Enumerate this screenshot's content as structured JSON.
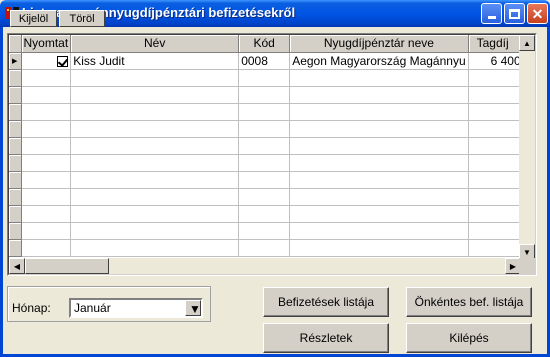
{
  "window": {
    "title": "Lista a magánnyugdíjpénztári befizetésekről"
  },
  "toolbar": {
    "select_label": "Kijelöl",
    "delete_label": "Töröl"
  },
  "grid": {
    "columns": [
      "Nyomtat",
      "Név",
      "Kód",
      "Nyugdíjpénztár neve",
      "Tagdíj"
    ],
    "rows": [
      {
        "print": true,
        "name": "Kiss Judit",
        "code": "0008",
        "fund": "Aegon Magyarország Magánnyu",
        "fee": "6 400"
      }
    ]
  },
  "month": {
    "label": "Hónap:",
    "value": "Január"
  },
  "buttons": {
    "payments_list": "Befizetések listája",
    "voluntary_list": "Önkéntes bef. listája",
    "details": "Részletek",
    "exit": "Kilépés"
  }
}
